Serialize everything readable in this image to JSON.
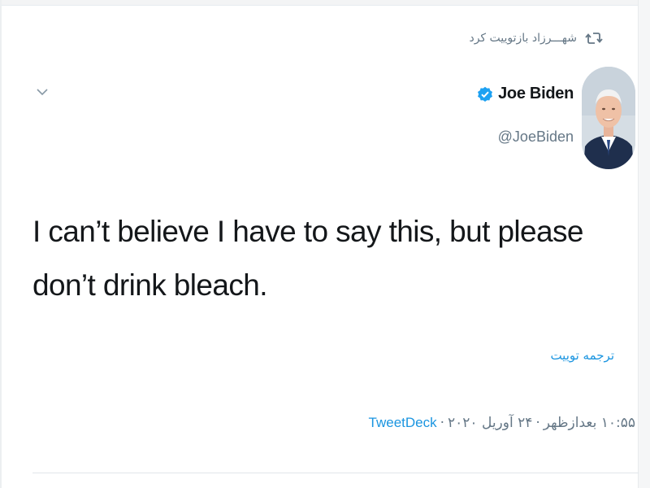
{
  "retweet": {
    "icon": "retweet-icon",
    "text": "شهـــرزاد بازتوییت کرد"
  },
  "author": {
    "name": "Joe Biden",
    "handle": "@JoeBiden",
    "verified": true,
    "verified_icon": "verified-badge-icon"
  },
  "tweet": {
    "text": "I can’t believe I have to say this, but please don’t drink bleach."
  },
  "actions": {
    "translate": "ترجمه توییت",
    "menu_icon": "chevron-down-icon"
  },
  "meta": {
    "time": "۱۰:۵۵ بعدازظهر",
    "separator": "·",
    "date": "۲۴ آوریل ۲۰۲۰",
    "source": "TweetDeck"
  },
  "colors": {
    "link": "#1b95e0",
    "secondary_text": "#657786",
    "primary_text": "#14171a",
    "verified": "#1da1f2"
  }
}
